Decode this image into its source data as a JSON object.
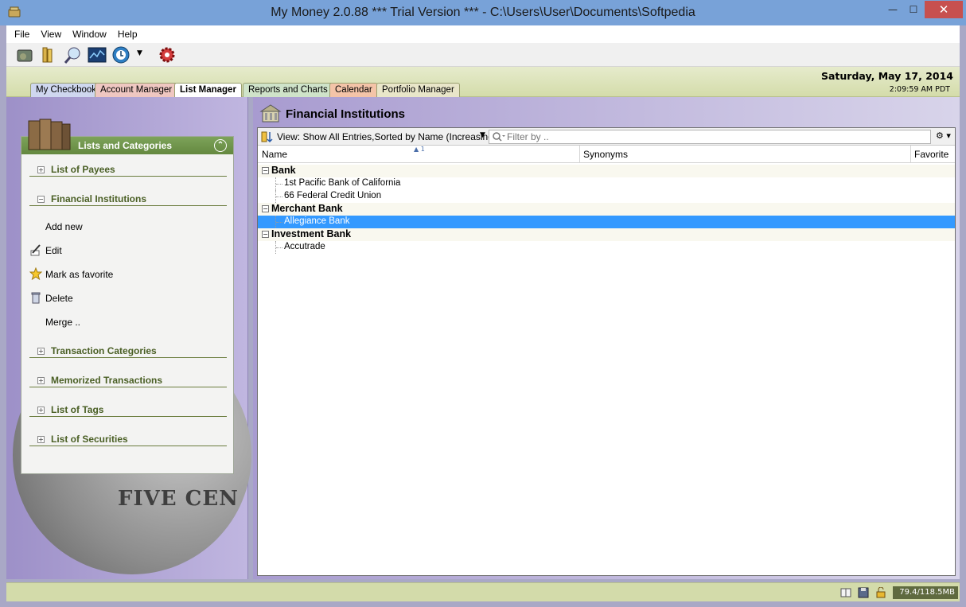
{
  "window": {
    "title": "My Money 2.0.88 *** Trial Version *** - C:\\Users\\User\\Documents\\Softpedia",
    "min": "—",
    "max": "☐",
    "close": "✕"
  },
  "menu": [
    "File",
    "View",
    "Window",
    "Help"
  ],
  "toolbar": {
    "icons": [
      "checkbook-icon",
      "books-icon",
      "magnifier-icon",
      "chart-icon",
      "download-icon",
      "gear-icon"
    ]
  },
  "tabs": [
    "My Checkbook",
    "Account Manager",
    "List Manager",
    "Reports and Charts",
    "Calendar",
    "Portfolio Manager"
  ],
  "active_tab": "List Manager",
  "header": {
    "date": "Saturday, May 17, 2014",
    "time": "2:09:59 AM PDT"
  },
  "left_panel": {
    "title": "Lists and Categories",
    "sections": {
      "payees": "List of Payees",
      "financial": "Financial Institutions",
      "categories": "Transaction Categories",
      "memorized": "Memorized Transactions",
      "tags": "List of Tags",
      "securities": "List of Securities"
    },
    "actions": {
      "add_new": "Add new",
      "edit": "Edit",
      "favorite": "Mark as favorite",
      "delete": "Delete",
      "merge": "Merge .."
    },
    "coin_text": "FIVE CENTS"
  },
  "main": {
    "title": "Financial Institutions",
    "view_label": "View: Show All Entries,Sorted by Name (Increasing)",
    "filter_placeholder": "Filter by ..",
    "sort_marker": "1",
    "columns": {
      "name": "Name",
      "synonyms": "Synonyms",
      "favorite": "Favorite"
    },
    "groups": {
      "bank": "Bank",
      "merchant": "Merchant Bank",
      "investment": "Investment Bank"
    },
    "rows": {
      "r1": "1st Pacific Bank of California",
      "r2": "66 Federal Credit Union",
      "r3": "Allegiance Bank",
      "r4": "Accutrade"
    },
    "selected_row": "Allegiance Bank"
  },
  "status": {
    "memory": "79.4/118.5MB"
  },
  "colors": {
    "accent_green": "#64883f",
    "selection": "#3399ff",
    "left_gradient": "#9d90c8"
  }
}
